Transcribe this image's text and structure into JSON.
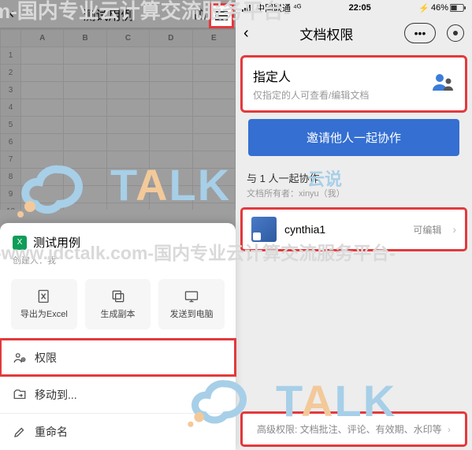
{
  "left": {
    "sheet_title": "测试用例",
    "panel_title": "测试用例",
    "panel_sub": "创建人：我",
    "actions": {
      "export": "导出为Excel",
      "copy": "生成副本",
      "send": "发送到电脑"
    },
    "rows": {
      "perm": "权限",
      "move": "移动到...",
      "rename": "重命名"
    },
    "cols": [
      "A",
      "B",
      "C",
      "D",
      "E"
    ]
  },
  "right": {
    "status": {
      "carrier": "中国联通",
      "signal": "⁴ᴳ",
      "time": "22:05",
      "battery": "46%"
    },
    "nav_title": "文档权限",
    "spec_title": "指定人",
    "spec_sub": "仅指定的人可查看/编辑文档",
    "invite": "邀请他人一起协作",
    "with_title": "与 1 人一起协作",
    "with_sub": "文档所有者：xinyu（我）",
    "collab_name": "cynthia1",
    "collab_perm": "可编辑",
    "advanced": "高级权限: 文档批注、评论、有效期、水印等"
  },
  "wm": {
    "top": "m-国内专业云计算交流服务平台-",
    "url": "-www.idctalk.com-国内专业云计算交流服务平台-",
    "cn": "云说"
  }
}
